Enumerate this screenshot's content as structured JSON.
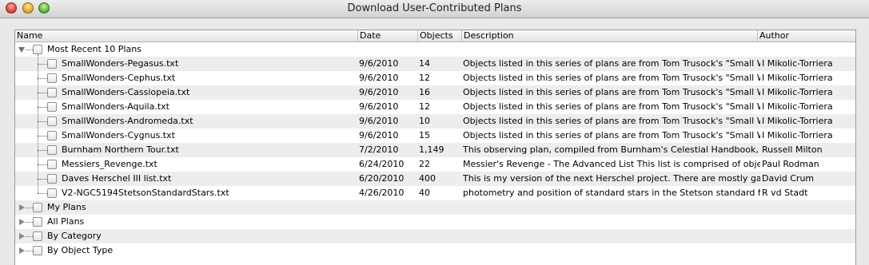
{
  "window": {
    "title": "Download User-Contributed Plans"
  },
  "columns": {
    "name": "Name",
    "date": "Date",
    "objects": "Objects",
    "description": "Description",
    "author": "Author"
  },
  "groups": [
    {
      "label": "Most Recent 10 Plans",
      "expanded": true
    },
    {
      "label": "My Plans",
      "expanded": false
    },
    {
      "label": "All Plans",
      "expanded": false
    },
    {
      "label": "By Category",
      "expanded": false
    },
    {
      "label": "By Object Type",
      "expanded": false
    }
  ],
  "plans": [
    {
      "name": "SmallWonders-Pegasus.txt",
      "date": "9/6/2010",
      "objects": "14",
      "description": "Objects listed in this series of plans are from Tom Trusock's \"Small W",
      "author": "I Mikolic-Torriera"
    },
    {
      "name": "SmallWonders-Cephus.txt",
      "date": "9/6/2010",
      "objects": "12",
      "description": "Objects listed in this series of plans are from Tom Trusock's \"Small W",
      "author": "I Mikolic-Torriera"
    },
    {
      "name": "SmallWonders-Cassiopeia.txt",
      "date": "9/6/2010",
      "objects": "16",
      "description": "Objects listed in this series of plans are from Tom Trusock's \"Small W",
      "author": "I Mikolic-Torriera"
    },
    {
      "name": "SmallWonders-Aquila.txt",
      "date": "9/6/2010",
      "objects": "12",
      "description": "Objects listed in this series of plans are from Tom Trusock's \"Small W",
      "author": "I Mikolic-Torriera"
    },
    {
      "name": "SmallWonders-Andromeda.txt",
      "date": "9/6/2010",
      "objects": "10",
      "description": "Objects listed in this series of plans are from Tom Trusock's \"Small W",
      "author": "I Mikolic-Torriera"
    },
    {
      "name": "SmallWonders-Cygnus.txt",
      "date": "9/6/2010",
      "objects": "15",
      "description": "Objects listed in this series of plans are from Tom Trusock's \"Small W",
      "author": "I Mikolic-Torriera"
    },
    {
      "name": "Burnham Northern Tour.txt",
      "date": "7/2/2010",
      "objects": "1,149",
      "description": "This observing plan, compiled from Burnham's Celestial Handbook, is",
      "author": "Russell Milton"
    },
    {
      "name": "Messiers_Revenge.txt",
      "date": "6/24/2010",
      "objects": "22",
      "description": "Messier's Revenge - The Advanced List This list is comprised of objec",
      "author": "Paul Rodman"
    },
    {
      "name": "Daves Herschel III list.txt",
      "date": "6/20/2010",
      "objects": "400",
      "description": "This is my version of the next Herschel project.  There are mostly gal",
      "author": "David Crum"
    },
    {
      "name": "V2-NGC5194StetsonStandardStars.txt",
      "date": "4/26/2010",
      "objects": "40",
      "description": "photometry and position of standard stars in the Stetson standard fie",
      "author": "R vd Stadt"
    }
  ]
}
